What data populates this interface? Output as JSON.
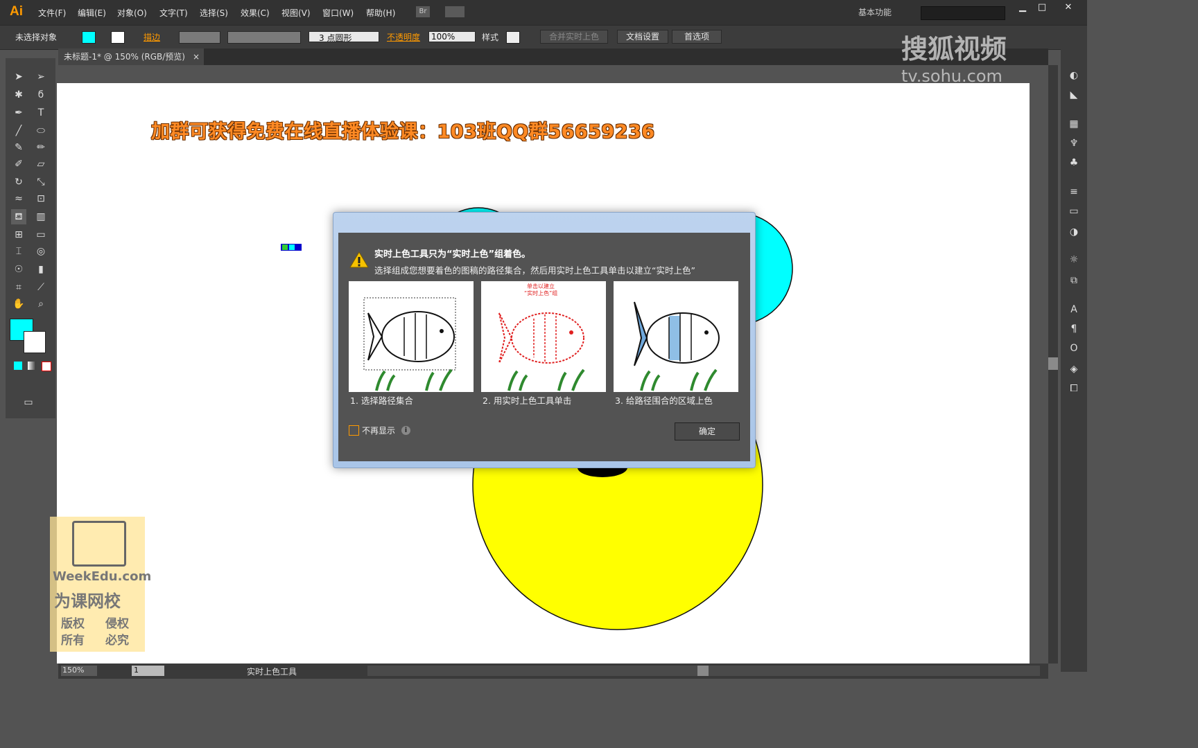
{
  "app": {
    "logo": "Ai",
    "workspace": "基本功能",
    "br": "Br"
  },
  "menu": [
    "文件(F)",
    "编辑(E)",
    "对象(O)",
    "文字(T)",
    "选择(S)",
    "效果(C)",
    "视图(V)",
    "窗口(W)",
    "帮助(H)"
  ],
  "control": {
    "selection": "未选择对象",
    "stroke_label": "描边",
    "brush": "3 点圆形",
    "opacity_label": "不透明度",
    "opacity_value": "100%",
    "style_label": "样式",
    "btn_live": "合并实时上色",
    "btn_doc": "文档设置",
    "btn_pref": "首选项"
  },
  "tab": {
    "title": "未标题-1* @ 150% (RGB/预览)",
    "close": "×"
  },
  "canvas": {
    "banner": "加群可获得免费在线直播体验课：103班QQ群56659236"
  },
  "dialog": {
    "title": "实时上色工具只为“实时上色”组着色。",
    "desc": "选择组成您想要着色的图稿的路径集合，然后用实时上色工具单击以建立“实时上色”",
    "panels": [
      {
        "caption": "1. 选择路径集合"
      },
      {
        "caption": "2. 用实时上色工具单击",
        "note1": "单击以建立",
        "note2": "“实时上色”组"
      },
      {
        "caption": "3. 给路径围合的区域上色"
      }
    ],
    "checkbox": "不再显示",
    "ok": "确定"
  },
  "status": {
    "zoom": "150%",
    "page": "1",
    "tool": "实时上色工具"
  },
  "watermark": {
    "brand": "搜狐视频",
    "url": "tv.sohu.com",
    "edu": "WeekEdu.com",
    "edu_cn": "为课网校",
    "r1": "版权",
    "r2": "侵权",
    "r3": "所有",
    "r4": "必究"
  },
  "colors": {
    "accent": "#ff9a00",
    "cyan": "#00ffff",
    "yellow": "#ffff00"
  }
}
